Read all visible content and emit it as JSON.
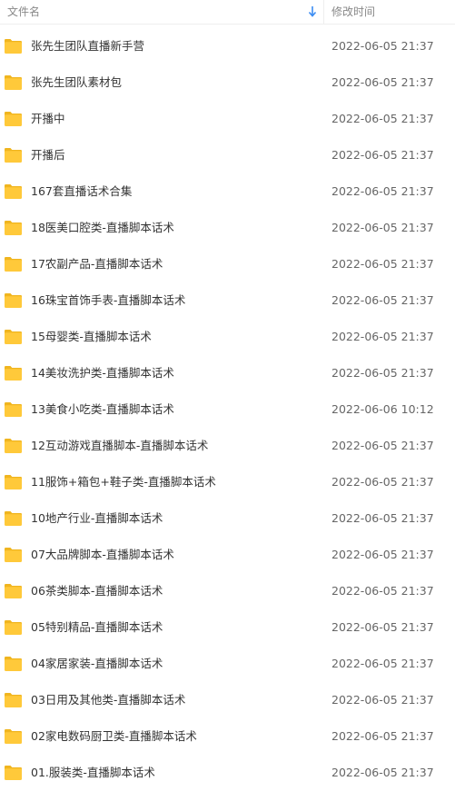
{
  "header": {
    "name_label": "文件名",
    "date_label": "修改时间",
    "sort_icon": "sort-down-arrow-icon",
    "sort_color": "#3b8cf2"
  },
  "folder_icon": {
    "name": "folder-icon",
    "color": "#ffc93a"
  },
  "files": [
    {
      "name": "张先生团队直播新手营",
      "modified": "2022-06-05 21:37"
    },
    {
      "name": "张先生团队素材包",
      "modified": "2022-06-05 21:37"
    },
    {
      "name": "开播中",
      "modified": "2022-06-05 21:37"
    },
    {
      "name": "开播后",
      "modified": "2022-06-05 21:37"
    },
    {
      "name": "167套直播话术合集",
      "modified": "2022-06-05 21:37"
    },
    {
      "name": "18医美口腔类-直播脚本话术",
      "modified": "2022-06-05 21:37"
    },
    {
      "name": "17农副产品-直播脚本话术",
      "modified": "2022-06-05 21:37"
    },
    {
      "name": "16珠宝首饰手表-直播脚本话术",
      "modified": "2022-06-05 21:37"
    },
    {
      "name": "15母婴类-直播脚本话术",
      "modified": "2022-06-05 21:37"
    },
    {
      "name": "14美妆洗护类-直播脚本话术",
      "modified": "2022-06-05 21:37"
    },
    {
      "name": "13美食小吃类-直播脚本话术",
      "modified": "2022-06-06 10:12"
    },
    {
      "name": "12互动游戏直播脚本-直播脚本话术",
      "modified": "2022-06-05 21:37"
    },
    {
      "name": "11服饰+箱包+鞋子类-直播脚本话术",
      "modified": "2022-06-05 21:37"
    },
    {
      "name": "10地产行业-直播脚本话术",
      "modified": "2022-06-05 21:37"
    },
    {
      "name": "07大品牌脚本-直播脚本话术",
      "modified": "2022-06-05 21:37"
    },
    {
      "name": "06茶类脚本-直播脚本话术",
      "modified": "2022-06-05 21:37"
    },
    {
      "name": "05特别精品-直播脚本话术",
      "modified": "2022-06-05 21:37"
    },
    {
      "name": "04家居家装-直播脚本话术",
      "modified": "2022-06-05 21:37"
    },
    {
      "name": "03日用及其他类-直播脚本话术",
      "modified": "2022-06-05 21:37"
    },
    {
      "name": "02家电数码厨卫类-直播脚本话术",
      "modified": "2022-06-05 21:37"
    },
    {
      "name": "01.服装类-直播脚本话术",
      "modified": "2022-06-05 21:37"
    }
  ]
}
